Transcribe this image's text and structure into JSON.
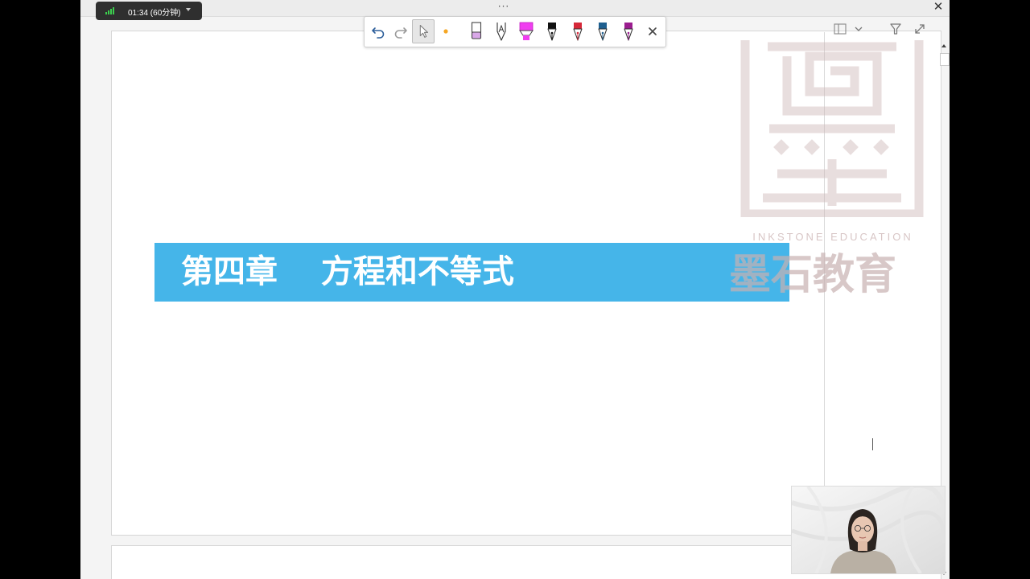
{
  "timer": {
    "text": "01:34 (60分钟)"
  },
  "titlebar": {
    "handle": "···",
    "close": "✕"
  },
  "slide": {
    "chapter_title": "第四章　 方程和不等式",
    "watermark_en": "INKSTONE EDUCATION",
    "watermark_cn": "墨石教育",
    "banner_color": "#45b5e9"
  },
  "annotation_toolbar": {
    "tools": [
      "undo",
      "redo",
      "select",
      "laser-pointer",
      "eraser",
      "pencil",
      "highlighter",
      "pen-black",
      "pen-red",
      "pen-blue",
      "pen-purple",
      "close"
    ],
    "colors": {
      "laser": "#f5a623",
      "highlighter": "#f03ef0",
      "pen_black": "#111111",
      "pen_red": "#d62839",
      "pen_blue": "#1e5f8f",
      "pen_purple": "#9b1d8f"
    },
    "close": "✕"
  },
  "right_tools": {
    "layout": "layout-icon",
    "filter": "filter-icon",
    "expand": "expand-icon"
  }
}
